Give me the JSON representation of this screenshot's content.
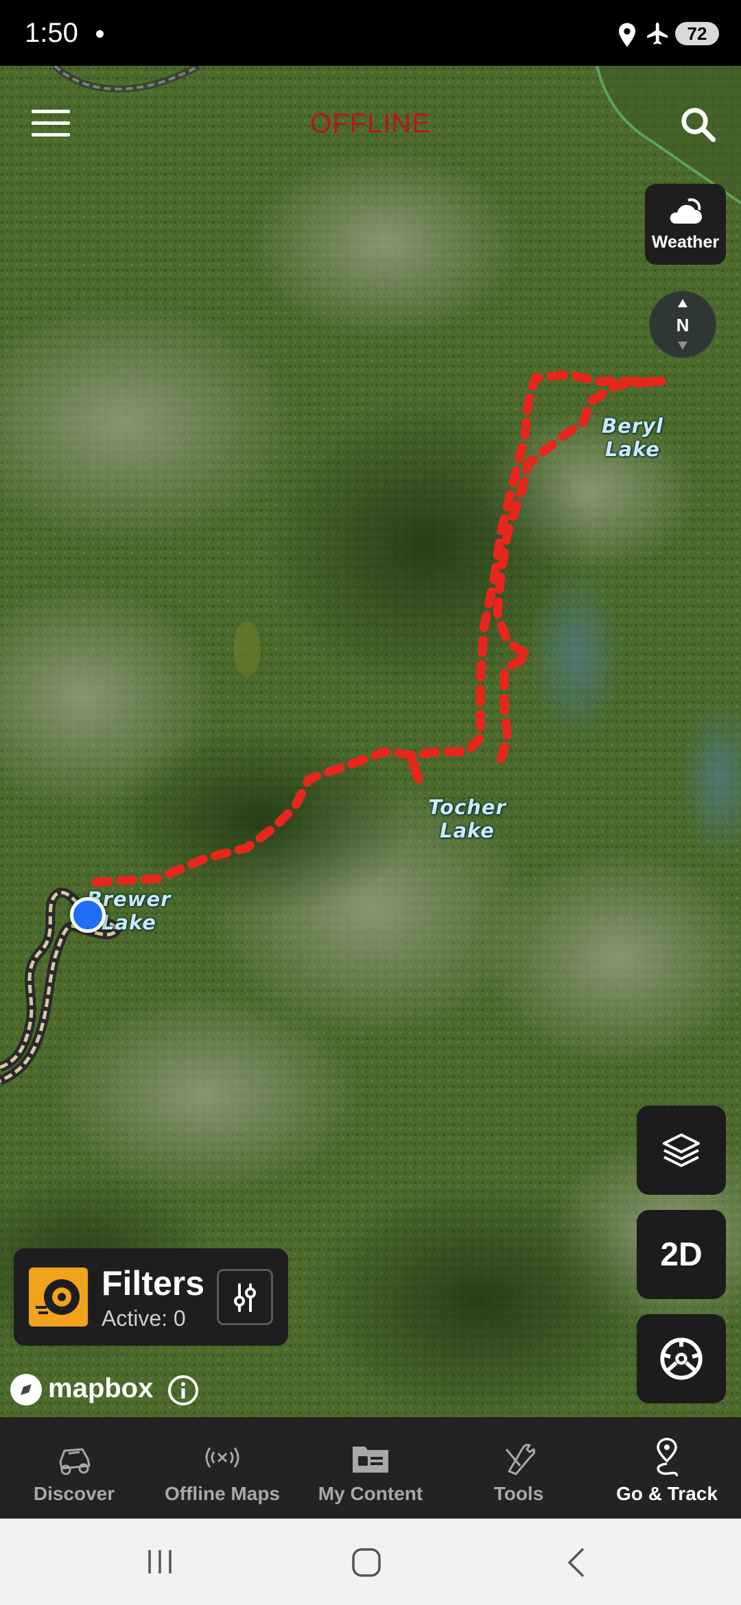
{
  "status_bar": {
    "time": "1:50",
    "battery": "72"
  },
  "header": {
    "offline_label": "OFFLINE"
  },
  "weather": {
    "label": "Weather"
  },
  "compass": {
    "letter": "N"
  },
  "map_labels": {
    "beryl": "Beryl\nLake",
    "tocher": "Tocher\nLake",
    "brewer": "Brewer\nLake"
  },
  "controls": {
    "view_mode": "2D"
  },
  "filters": {
    "title": "Filters",
    "active": "Active: 0"
  },
  "attribution": {
    "brand": "mapbox"
  },
  "nav": {
    "items": [
      {
        "label": "Discover",
        "icon": "jeep-icon"
      },
      {
        "label": "Offline Maps",
        "icon": "signal-icon"
      },
      {
        "label": "My Content",
        "icon": "folder-icon"
      },
      {
        "label": "Tools",
        "icon": "tools-icon"
      },
      {
        "label": "Go & Track",
        "icon": "route-pin-icon"
      }
    ],
    "active": "Go & Track"
  },
  "colors": {
    "trail": "#e8261b",
    "user_location": "#1e6ff5",
    "tools_accent": "#f2a21b",
    "offline_text": "#b81818"
  }
}
